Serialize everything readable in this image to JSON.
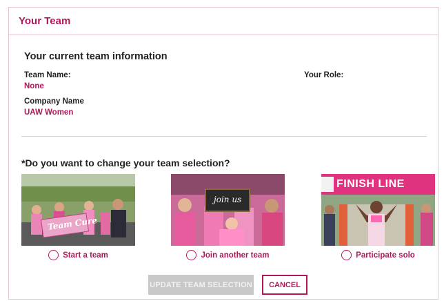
{
  "card": {
    "title": "Your Team"
  },
  "team_info": {
    "heading": "Your current team information",
    "team_name_label": "Team Name:",
    "team_name_value": "None",
    "role_label": "Your Role:",
    "company_label": "Company Name",
    "company_value": "UAW Women"
  },
  "selection": {
    "question": "*Do you want to change your team selection?",
    "options": [
      {
        "label": "Start a team",
        "photo_sign": "Team Cure",
        "selected": false
      },
      {
        "label": "Join another team",
        "photo_sign": "join us",
        "selected": false
      },
      {
        "label": "Participate solo",
        "photo_sign": "FINISH LINE",
        "selected": false
      }
    ]
  },
  "buttons": {
    "update": "UPDATE TEAM SELECTION",
    "cancel": "CANCEL"
  },
  "colors": {
    "accent": "#b1185c",
    "border": "#e6c3d4",
    "divider": "#efbfd3",
    "disabled_button": "#c8c8c8"
  }
}
